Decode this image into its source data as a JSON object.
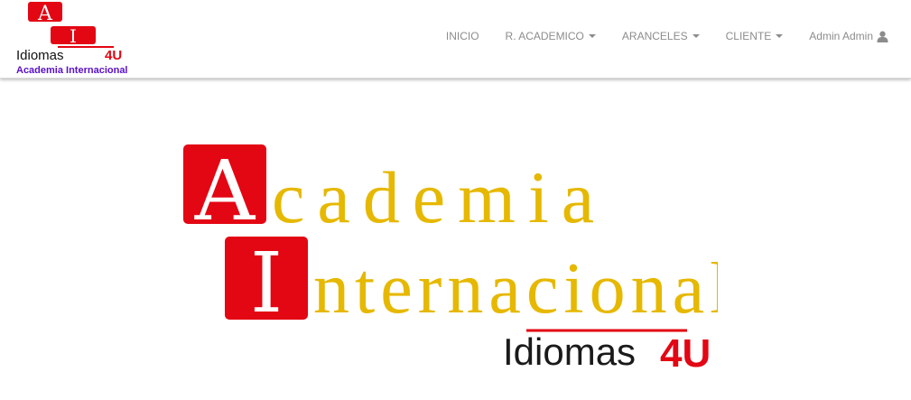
{
  "brand": {
    "logo_letter_top": "A",
    "logo_letter_bottom": "I",
    "logo_word": "Idiomas",
    "logo_suffix": "4U",
    "caption": "Academia Internacional"
  },
  "nav": {
    "items": [
      {
        "label": "INICIO",
        "dropdown": false
      },
      {
        "label": "R. ACADEMICO",
        "dropdown": true
      },
      {
        "label": "ARANCELES",
        "dropdown": true
      },
      {
        "label": "CLIENTE",
        "dropdown": true
      }
    ],
    "user": {
      "label": "Admin Admin",
      "icon": "user-icon"
    }
  },
  "hero": {
    "line1_initial": "A",
    "line1_rest": "cademia",
    "line2_initial": "I",
    "line2_rest": "nternacional",
    "tagline": "Idiomas",
    "tagline_suffix": "4U"
  },
  "colors": {
    "brand_red": "#e30613",
    "hero_gold": "#e6b800",
    "caption_purple": "#5a0fc8",
    "nav_text": "#8c8c8c",
    "dark_text": "#1a1a1a"
  }
}
